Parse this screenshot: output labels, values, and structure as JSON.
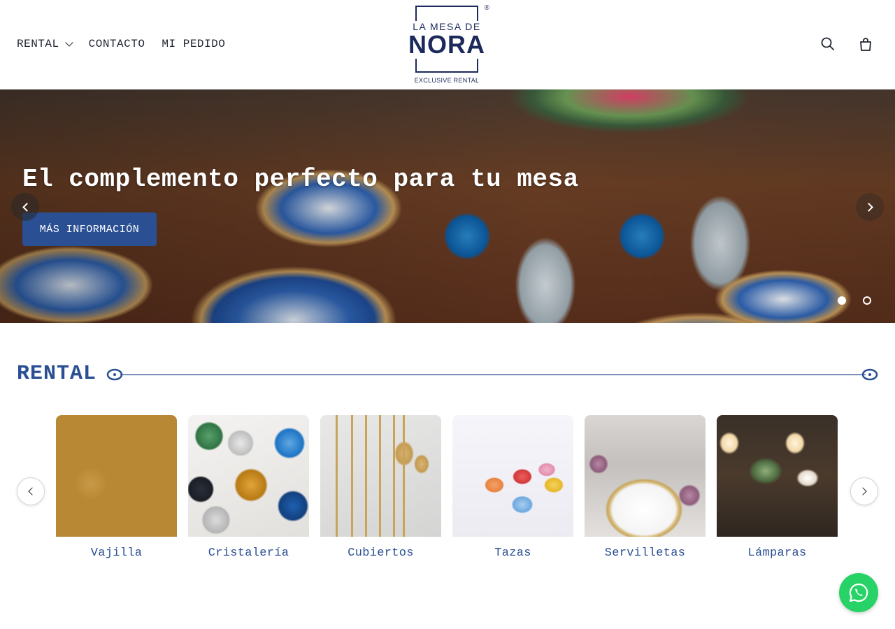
{
  "header": {
    "nav": [
      {
        "label": "RENTAL",
        "has_dropdown": true
      },
      {
        "label": "CONTACTO",
        "has_dropdown": false
      },
      {
        "label": "MI PEDIDO",
        "has_dropdown": false
      }
    ],
    "logo": {
      "line1": "LA MESA DE",
      "line2": "NORA",
      "line3": "EXCLUSIVE RENTAL",
      "reg": "®"
    },
    "icons": [
      "search-icon",
      "cart-icon"
    ]
  },
  "hero": {
    "title": "El complemento perfecto para tu mesa",
    "button_label": "MÁS INFORMACIÓN",
    "slides_count": 2,
    "active_slide": 1
  },
  "rental": {
    "title": "RENTAL",
    "categories": [
      {
        "label": "Vajilla"
      },
      {
        "label": "Cristalería"
      },
      {
        "label": "Cubiertos"
      },
      {
        "label": "Tazas"
      },
      {
        "label": "Servilletas"
      },
      {
        "label": "Lámparas"
      }
    ]
  },
  "colors": {
    "brand_blue": "#2a4f93",
    "dark_navy": "#1b2a5b",
    "whatsapp_green": "#27d366"
  }
}
